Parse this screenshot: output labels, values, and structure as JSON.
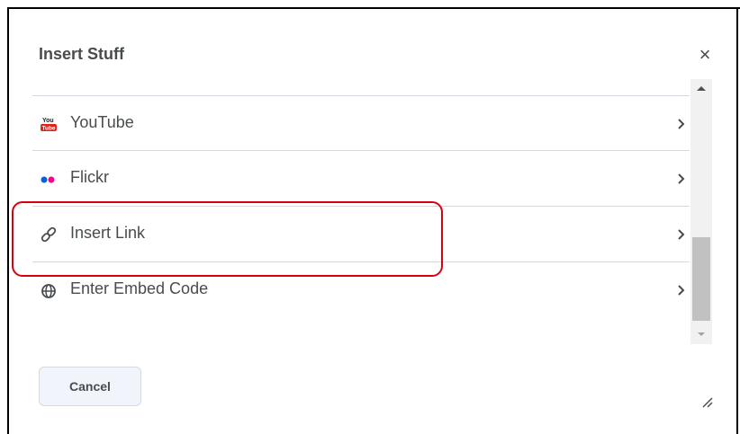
{
  "dialog": {
    "title": "Insert Stuff",
    "close_label": "×"
  },
  "items": [
    {
      "label": "YouTube",
      "icon": "youtube-icon"
    },
    {
      "label": "Flickr",
      "icon": "flickr-icon"
    },
    {
      "label": "Insert Link",
      "icon": "link-icon"
    },
    {
      "label": "Enter Embed Code",
      "icon": "globe-icon"
    }
  ],
  "footer": {
    "cancel_label": "Cancel"
  },
  "colors": {
    "text": "#494c4e",
    "divider": "#d3d9e3",
    "highlight": "#d9000e",
    "youtube_red": "#e62117",
    "flickr_blue": "#0063dc",
    "flickr_pink": "#ff0084"
  }
}
